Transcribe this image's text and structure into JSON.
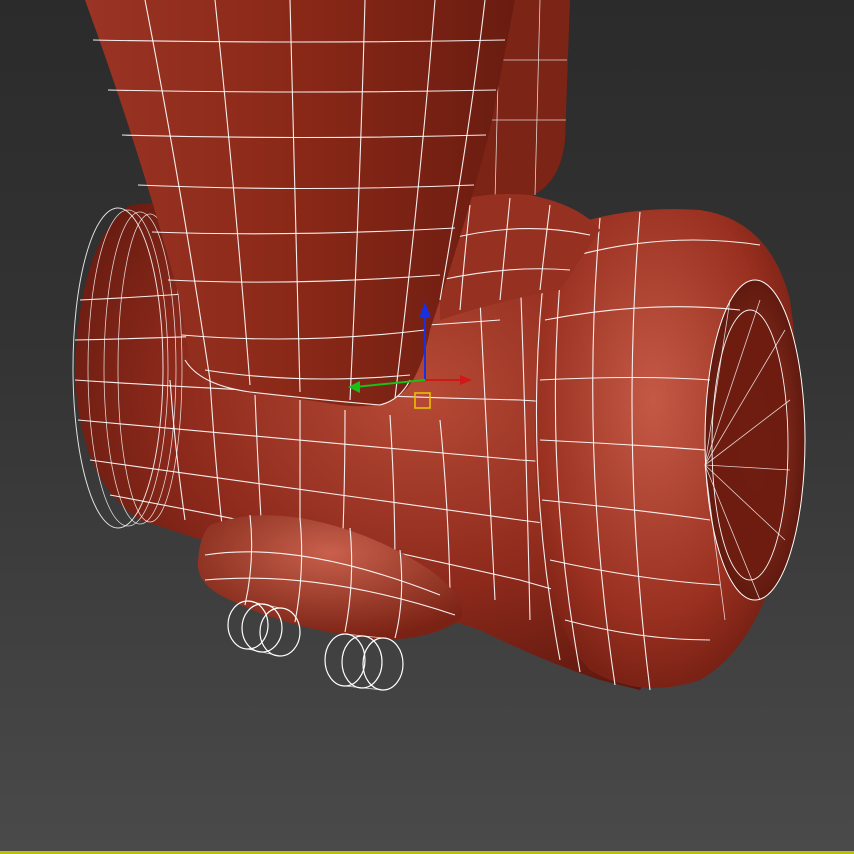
{
  "viewport": {
    "background_top": "#2b2b2b",
    "background_bottom": "#4a4a4a",
    "active_frame_color": "#b8c000"
  },
  "model": {
    "surface_color": "#8e2a1c",
    "highlight_color": "#c35a48",
    "shadow_color": "#4a1008",
    "wire_color": "#ffffff",
    "display_mode": "smooth-shaded-with-edged-faces"
  },
  "gizmo": {
    "type": "move-transform-gizmo",
    "x_axis_color": "#d01818",
    "y_axis_color": "#18c018",
    "z_axis_color": "#1830e0",
    "plane_handle_color": "#e8c000"
  }
}
